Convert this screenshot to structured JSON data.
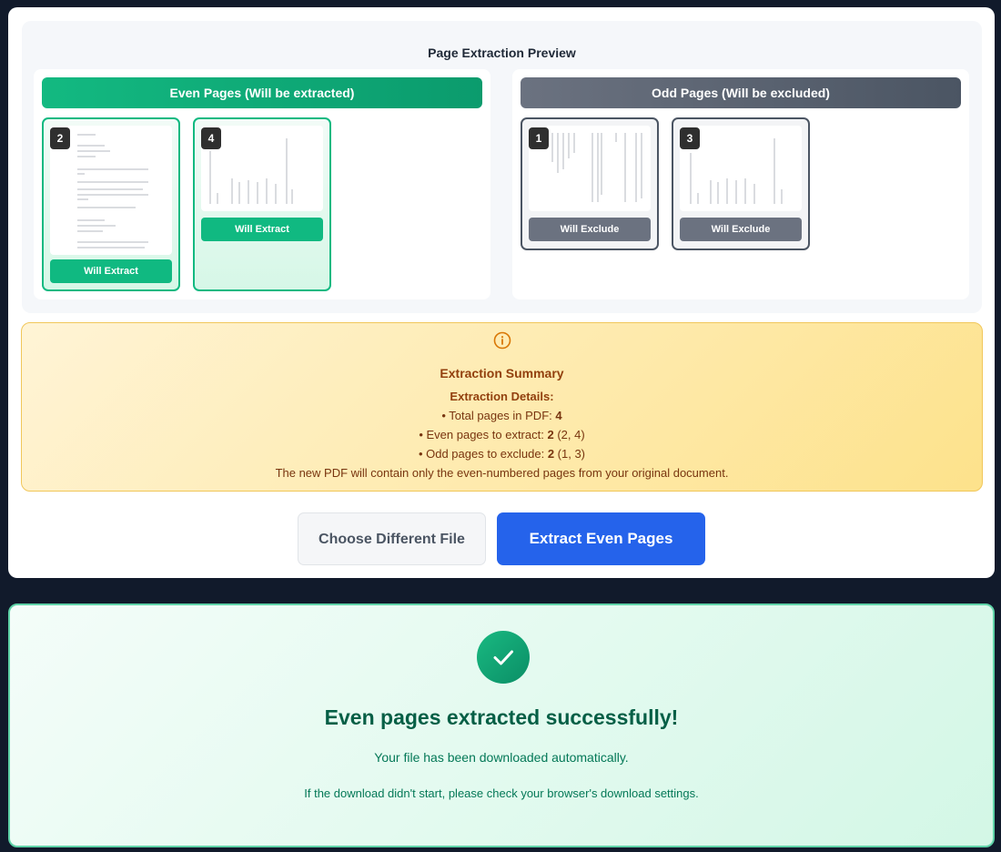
{
  "preview": {
    "title": "Page Extraction Preview",
    "even_header": "Even Pages (Will be extracted)",
    "odd_header": "Odd Pages (Will be excluded)",
    "even_pages": [
      {
        "number": "2",
        "action": "Will Extract"
      },
      {
        "number": "4",
        "action": "Will Extract"
      }
    ],
    "odd_pages": [
      {
        "number": "1",
        "action": "Will Exclude"
      },
      {
        "number": "3",
        "action": "Will Exclude"
      }
    ]
  },
  "summary": {
    "title": "Extraction Summary",
    "details_label": "Extraction Details:",
    "total_label": "• Total pages in PDF: ",
    "total_value": "4",
    "even_label": "• Even pages to extract: ",
    "even_value": "2",
    "even_list": " (2, 4)",
    "odd_label": "• Odd pages to exclude: ",
    "odd_value": "2",
    "odd_list": " (1, 3)",
    "note": "The new PDF will contain only the even-numbered pages from your original document."
  },
  "actions": {
    "choose_label": "Choose Different File",
    "extract_label": "Extract Even Pages"
  },
  "success": {
    "title": "Even pages extracted successfully!",
    "message": "Your file has been downloaded automatically.",
    "note": "If the download didn't start, please check your browser's download settings."
  },
  "colors": {
    "even_accent": "#10b981",
    "odd_accent": "#6b7280",
    "primary": "#2563eb",
    "summary_text": "#92400e",
    "success_text": "#065f46"
  },
  "icons": {
    "summary": "info-circle-icon",
    "success": "check-icon"
  }
}
